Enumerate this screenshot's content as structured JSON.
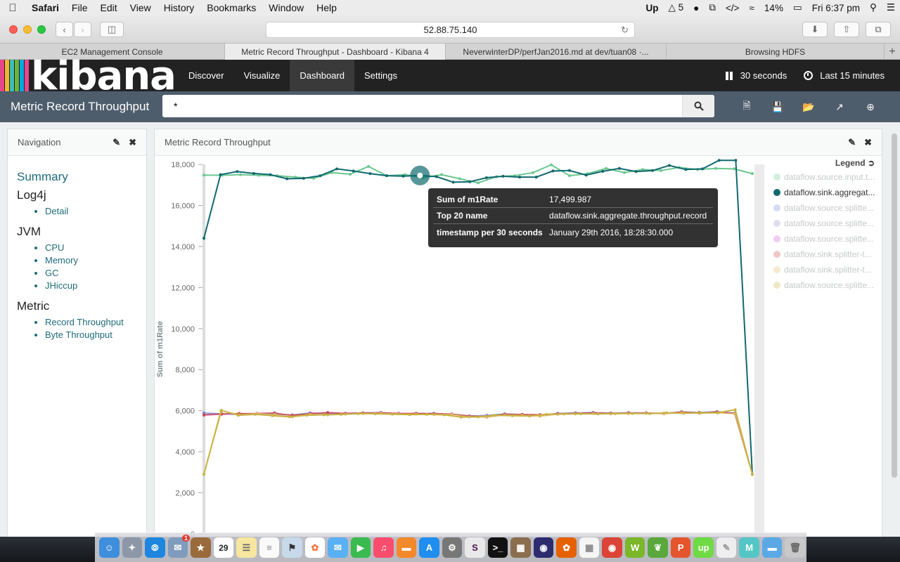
{
  "menubar": {
    "app": "Safari",
    "items": [
      "File",
      "Edit",
      "View",
      "History",
      "Bookmarks",
      "Window",
      "Help"
    ],
    "status": {
      "upwork": "Up",
      "adobe": "5",
      "battery": "14%",
      "clock": "Fri 6:37 pm"
    }
  },
  "browser": {
    "address": "52.88.75.140",
    "tabs": [
      {
        "label": "EC2 Management Console"
      },
      {
        "label": "Metric Record Throughput - Dashboard - Kibana 4"
      },
      {
        "label": "NeverwinterDP/perfJan2016.md at dev/tuan08 ·..."
      },
      {
        "label": "Browsing HDFS"
      }
    ],
    "new_tab": "+"
  },
  "kibana": {
    "logo": "kibana",
    "logo_colors": [
      "#e8478b",
      "#f0b72f",
      "#3ebeb0",
      "#6db33f",
      "#00a9e0",
      "#e8478b"
    ],
    "nav": [
      "Discover",
      "Visualize",
      "Dashboard",
      "Settings"
    ],
    "refresh": "30 seconds",
    "time": "Last 15 minutes"
  },
  "dashboard": {
    "title": "Metric Record Throughput",
    "query": "*"
  },
  "navigation_panel": {
    "title": "Navigation",
    "summary": "Summary",
    "log4j": {
      "title": "Log4j",
      "items": [
        "Detail"
      ]
    },
    "jvm": {
      "title": "JVM",
      "items": [
        "CPU",
        "Memory",
        "GC",
        "JHiccup"
      ]
    },
    "metric": {
      "title": "Metric",
      "items": [
        "Record Throughput",
        "Byte Throughput"
      ]
    }
  },
  "chart_panel": {
    "title": "Metric Record Throughput",
    "legend_title": "Legend",
    "tooltip": {
      "rows": [
        {
          "k": "Sum of m1Rate",
          "v": "17,499.987"
        },
        {
          "k": "Top 20 name",
          "v": "dataflow.sink.aggregate.throughput.record"
        },
        {
          "k": "timestamp per 30 seconds",
          "v": "January 29th 2016, 18:28:30.000"
        }
      ]
    }
  },
  "chart_data": {
    "type": "line",
    "ylabel": "Sum of m1Rate",
    "ylim": [
      0,
      18000
    ],
    "yticks": [
      "0",
      "2,000",
      "4,000",
      "6,000",
      "8,000",
      "10,000",
      "12,000",
      "14,000",
      "16,000",
      "18,000"
    ],
    "series": [
      {
        "name": "dataflow.source.input.t...",
        "color": "#6cc791",
        "dim": false,
        "values": [
          17480,
          17470,
          17500,
          17470,
          17450,
          17380,
          17320,
          17600,
          17520,
          17900,
          17450,
          17500,
          17350,
          17500,
          17300,
          17100,
          17400,
          17450,
          17600,
          17980,
          17450,
          17550,
          17800,
          17600,
          17750,
          17700,
          17850,
          17750,
          17800,
          17780,
          17550
        ]
      },
      {
        "name": "dataflow.sink.aggregat...",
        "color": "#10696e",
        "dim": false,
        "values": [
          14400,
          17500,
          17650,
          17560,
          17500,
          17300,
          17320,
          17450,
          17780,
          17680,
          17550,
          17450,
          17430,
          17460,
          17400,
          17130,
          17150,
          17350,
          17420,
          17380,
          17380,
          17680,
          17700,
          17480,
          17660,
          17800,
          17650,
          17700,
          17950,
          17750,
          17780,
          18200,
          18200,
          2900
        ]
      },
      {
        "name": "dataflow.source.splitte...",
        "color": "#6f87d8",
        "dim": true,
        "values": [
          5900,
          5850,
          5800,
          5850,
          5820,
          5800,
          5900,
          5850,
          5880,
          5900,
          5920,
          5850,
          5870,
          5880,
          5820,
          5750,
          5780,
          5850,
          5820,
          5780,
          5880,
          5900,
          5920,
          5880,
          5910,
          5900,
          5880,
          5950,
          5920,
          5960,
          5890,
          2900
        ]
      },
      {
        "name": "dataflow.source.splitte...",
        "color": "#a28bd2",
        "dim": true,
        "values": [
          5820,
          5860,
          5820,
          5870,
          5840,
          5800,
          5850,
          5880,
          5860,
          5890,
          5900,
          5870,
          5850,
          5870,
          5840,
          5760,
          5760,
          5830,
          5810,
          5800,
          5860,
          5880,
          5910,
          5890,
          5900,
          5880,
          5860,
          5930,
          5900,
          5930,
          5870,
          2900
        ]
      },
      {
        "name": "dataflow.source.splitte...",
        "color": "#d35ad2",
        "dim": true,
        "values": [
          5780,
          5820,
          5850,
          5880,
          5900,
          5760,
          5870,
          5920,
          5880,
          5900,
          5910,
          5880,
          5860,
          5860,
          5830,
          5730,
          5700,
          5820,
          5800,
          5780,
          5860,
          5870,
          5900,
          5870,
          5880,
          5900,
          5850,
          5910,
          5880,
          5950,
          5860,
          2900
        ]
      },
      {
        "name": "dataflow.sink.splitter-t...",
        "color": "#c94a3e",
        "dim": true,
        "values": [
          5800,
          5850,
          5870,
          5860,
          5880,
          5780,
          5860,
          5900,
          5870,
          5890,
          5900,
          5870,
          5880,
          5860,
          5840,
          5740,
          5720,
          5830,
          5820,
          5810,
          5850,
          5880,
          5890,
          5880,
          5890,
          5890,
          5870,
          5940,
          5900,
          5940,
          5870,
          2900
        ]
      },
      {
        "name": "dataflow.sink.splitter-t...",
        "color": "#e0b66a",
        "dim": true,
        "values": [
          2900,
          6000,
          5800,
          5870,
          5820,
          5700,
          5820,
          5790,
          5830,
          5860,
          5880,
          5840,
          5830,
          5820,
          5820,
          5700,
          5680,
          5790,
          5780,
          5730,
          5820,
          5840,
          5860,
          5840,
          5860,
          5870,
          5850,
          5900,
          5870,
          5900,
          5850,
          2900
        ]
      },
      {
        "name": "dataflow.source.splitte...",
        "color": "#c9b340",
        "dim": false,
        "values": [
          2900,
          6020,
          5780,
          5820,
          5760,
          5700,
          5780,
          5800,
          5820,
          5860,
          5850,
          5830,
          5810,
          5820,
          5800,
          5690,
          5700,
          5780,
          5760,
          5740,
          5820,
          5840,
          5850,
          5840,
          5860,
          5870,
          5860,
          5900,
          5880,
          5900,
          5900,
          6050,
          2900
        ]
      }
    ]
  },
  "dock": {
    "calendar_day": "29",
    "badge": "1"
  }
}
